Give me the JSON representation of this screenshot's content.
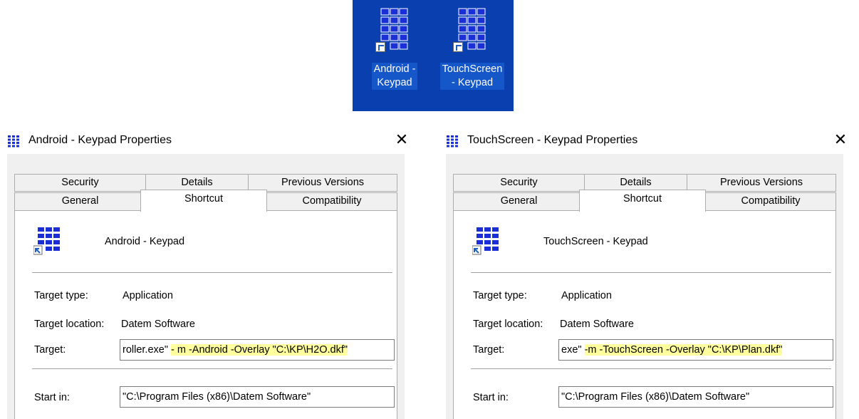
{
  "desktop": {
    "icons": [
      {
        "label": "Android -\nKeypad"
      },
      {
        "label": "TouchScreen\n- Keypad"
      }
    ]
  },
  "dialogs": [
    {
      "title": "Android -  Keypad Properties",
      "close_glyph": "✕",
      "tabs": {
        "security": "Security",
        "details": "Details",
        "previous_versions": "Previous Versions",
        "general": "General",
        "shortcut": "Shortcut",
        "compatibility": "Compatibility"
      },
      "shortcut_name": "Android -  Keypad",
      "target_type_label": "Target type:",
      "target_type": "Application",
      "target_location_label": "Target location:",
      "target_location": "Datem Software",
      "target_label": "Target:",
      "target_plain": "roller.exe\" ",
      "target_highlight": "- m -Android -Overlay \"C:\\KP\\H2O.dkf\"",
      "start_in_label": "Start in:",
      "start_in": "\"C:\\Program Files (x86)\\Datem Software\""
    },
    {
      "title": "TouchScreen - Keypad Properties",
      "close_glyph": "✕",
      "tabs": {
        "security": "Security",
        "details": "Details",
        "previous_versions": "Previous Versions",
        "general": "General",
        "shortcut": "Shortcut",
        "compatibility": "Compatibility"
      },
      "shortcut_name": "TouchScreen - Keypad",
      "target_type_label": "Target type:",
      "target_type": "Application",
      "target_location_label": "Target location:",
      "target_location": "Datem Software",
      "target_label": "Target:",
      "target_plain": "exe\" ",
      "target_highlight": "-m -TouchScreen -Overlay \"C:\\KP\\Plan.dkf\"",
      "start_in_label": "Start in:",
      "start_in": "\"C:\\Program Files (x86)\\Datem Software\""
    }
  ],
  "icons": {
    "app": "keypad-grid-icon",
    "shortcut_badge": "shortcut-arrow-icon",
    "close": "close-icon"
  },
  "colors": {
    "desktop_bg": "#0a3fb0",
    "icon_blue": "#1a2fd6",
    "target_highlight": "#ffff9e"
  }
}
